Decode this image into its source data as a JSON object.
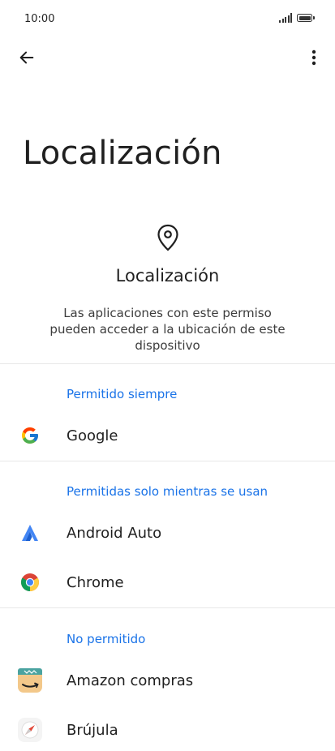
{
  "status_bar": {
    "time": "10:00"
  },
  "icons": {
    "back": "arrow-left-icon",
    "more": "more-vertical-icon",
    "hero": "location-pin-icon"
  },
  "page": {
    "title": "Localización"
  },
  "hero": {
    "title": "Localización",
    "description": "Las aplicaciones con este permiso pueden acceder a la ubicación de este dispositivo"
  },
  "sections": [
    {
      "header": "Permitido siempre",
      "apps": [
        {
          "label": "Google",
          "icon": "google-icon"
        }
      ]
    },
    {
      "header": "Permitidas solo mientras se usan",
      "apps": [
        {
          "label": "Android Auto",
          "icon": "android-auto-icon"
        },
        {
          "label": "Chrome",
          "icon": "chrome-icon"
        }
      ]
    },
    {
      "header": "No permitido",
      "apps": [
        {
          "label": "Amazon compras",
          "icon": "amazon-icon"
        },
        {
          "label": "Brújula",
          "icon": "compass-icon"
        }
      ]
    }
  ],
  "colors": {
    "accent": "#1a73e8",
    "text": "#1f1f1f",
    "divider": "#e8e8e8"
  }
}
